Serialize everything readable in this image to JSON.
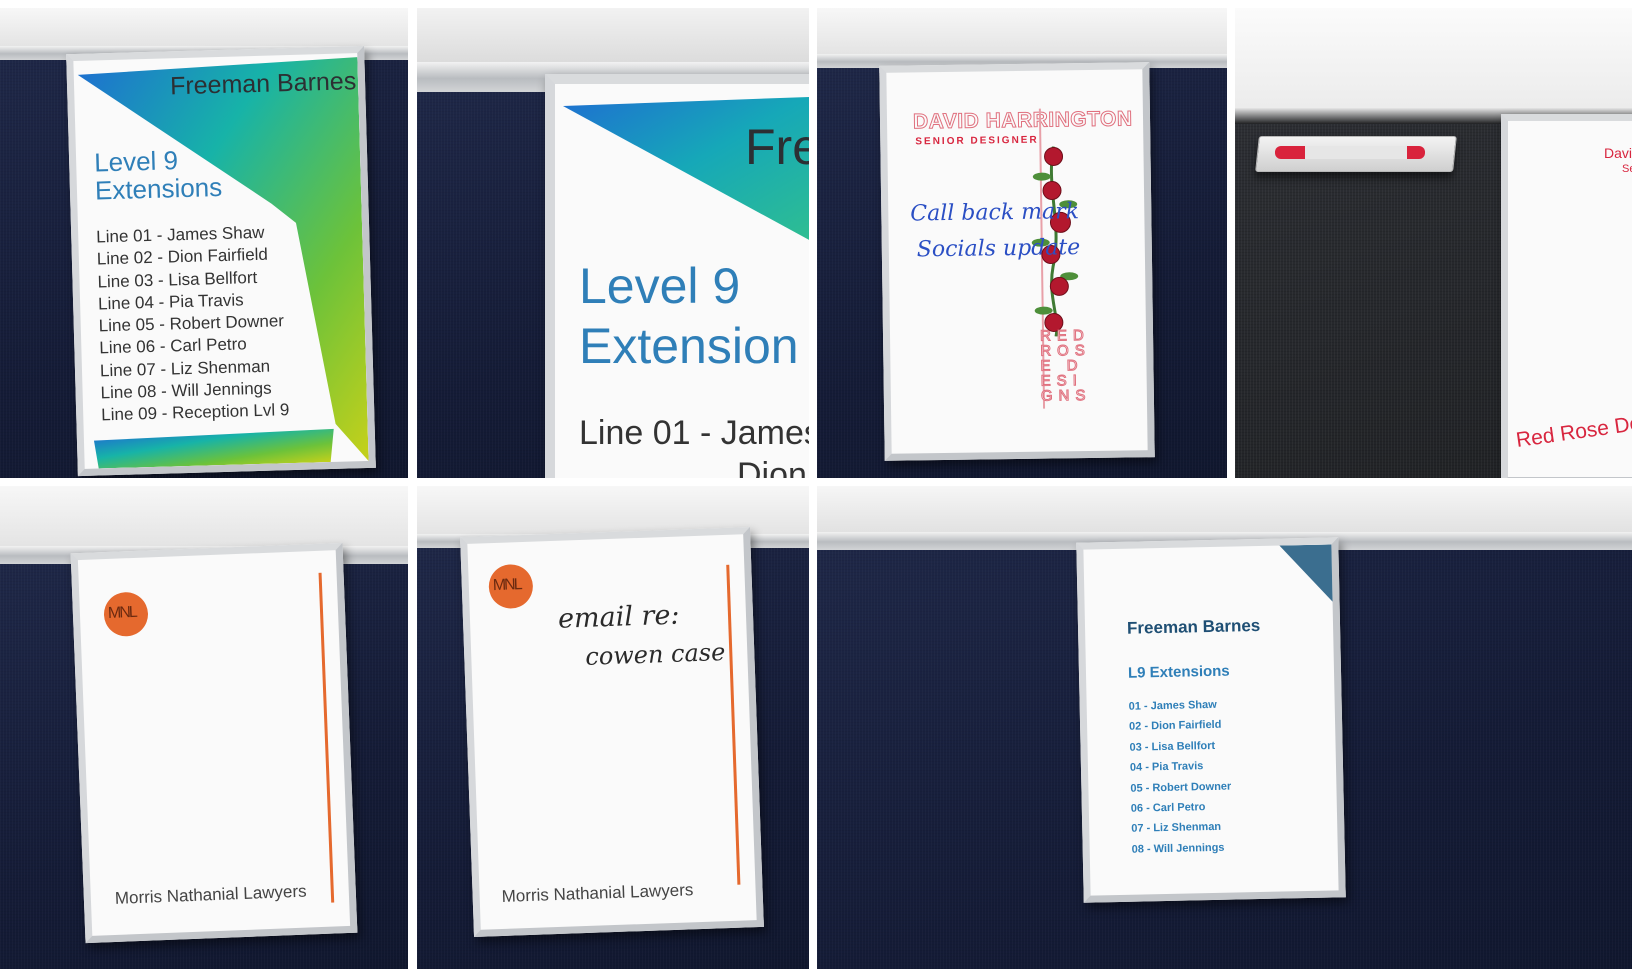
{
  "tile1": {
    "company": "Freeman Barnes",
    "heading_line1": "Level 9",
    "heading_line2": "Extensions",
    "lines": [
      "Line 01  - James Shaw",
      "Line 02 - Dion Fairfield",
      "Line 03 - Lisa Bellfort",
      "Line 04 - Pia Travis",
      "Line 05 - Robert Downer",
      "Line 06 - Carl Petro",
      "Line 07 - Liz Shenman",
      "Line 08 - Will Jennings",
      "Line 09 - Reception Lvl 9"
    ]
  },
  "tile2": {
    "company_partial": "Fre",
    "heading_line1": "Level 9",
    "heading_line2": "Extension",
    "line_partial": "Line 01  - James",
    "line_partial2": "Dion"
  },
  "tile3": {
    "name": "DAVID HARRINGTON",
    "title": "SENIOR DESIGNER",
    "note_line1": "Call back mark",
    "note_line2": "Socials update",
    "vertical_text": "RED ROSE DESIGNS"
  },
  "tile4": {
    "name_partial": "David",
    "title_partial": "Sen",
    "brand_partial": "Red Rose Des"
  },
  "tile5": {
    "logo": "MNL",
    "firm": "Morris Nathanial Lawyers"
  },
  "tile6": {
    "logo": "MNL",
    "note_line1": "email re:",
    "note_line2": "cowen case",
    "firm": "Morris Nathanial Lawyers"
  },
  "tile7": {
    "company": "Freeman Barnes",
    "heading": "L9 Extensions",
    "lines": [
      "01 - James Shaw",
      "02 - Dion Fairfield",
      "03 - Lisa Bellfort",
      "04 - Pia Travis",
      "05 - Robert Downer",
      "06 - Carl Petro",
      "07 - Liz Shenman",
      "08 - Will Jennings"
    ]
  },
  "colors": {
    "fabric_navy": "#161d3a",
    "freeman_blue": "#2f7fb8",
    "freeman_dark": "#1f4f74",
    "rose_red": "#d8263f",
    "mnl_orange": "#e5692e",
    "marker_blue": "#2b4fc4"
  }
}
